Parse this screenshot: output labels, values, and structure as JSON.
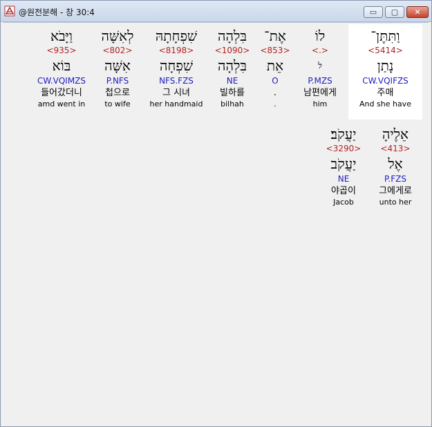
{
  "window": {
    "title": "@원전분해 - 창 30:4",
    "min_glyph": "▭",
    "max_glyph": "▢",
    "close_glyph": "✕",
    "close_color": "#c4432a",
    "parse_color": "#1c1cc0",
    "strong_color": "#b22222"
  },
  "rows": [
    {
      "words": [
        {
          "heb": "וַתִּתֶּן־",
          "strong": "<5414>",
          "lemma": "נָתַן",
          "parse": "CW.VQIFZS",
          "kor": "주매",
          "eng": "And she have",
          "selected": true
        },
        {
          "heb": "לוֹ",
          "strong": "<.>",
          "lemma": "ל",
          "parse": "P.MZS",
          "kor": "남편에게",
          "eng": "him",
          "selected": false
        },
        {
          "heb": "אֶת־",
          "strong": "<853>",
          "lemma": "אֵת",
          "parse": "O",
          "kor": ".",
          "eng": ".",
          "selected": false
        },
        {
          "heb": "בִּלְהָה",
          "strong": "<1090>",
          "lemma": "בִּלְהָה",
          "parse": "NE",
          "kor": "빌하를",
          "eng": "bilhah",
          "selected": false
        },
        {
          "heb": "שִׁפְחָתָהּ",
          "strong": "<8198>",
          "lemma": "שִׁפְחָה",
          "parse": "NFS.FZS",
          "kor": "그 시녀",
          "eng": "her handmaid",
          "selected": false
        },
        {
          "heb": "לְאִשָּׁה",
          "strong": "<802>",
          "lemma": "אִשָּׁה",
          "parse": "P.NFS",
          "kor": "첩으로",
          "eng": "to wife",
          "selected": false
        },
        {
          "heb": "וַיָּבֹא",
          "strong": "<935>",
          "lemma": "בּוֹא",
          "parse": "CW.VQIMZS",
          "kor": "들어갔더니",
          "eng": "amd went in",
          "selected": false
        }
      ]
    },
    {
      "words": [
        {
          "heb": "אֵלֶיהָ",
          "strong": "<413>",
          "lemma": "אֶל",
          "parse": "P.FZS",
          "kor": "그에게로",
          "eng": "unto her",
          "selected": false
        },
        {
          "heb": "יַעֲקֹב׃",
          "strong": "<3290>",
          "lemma": "יַעֲקֹב",
          "parse": "NE",
          "kor": "야곱이",
          "eng": "Jacob",
          "selected": false
        }
      ]
    }
  ]
}
